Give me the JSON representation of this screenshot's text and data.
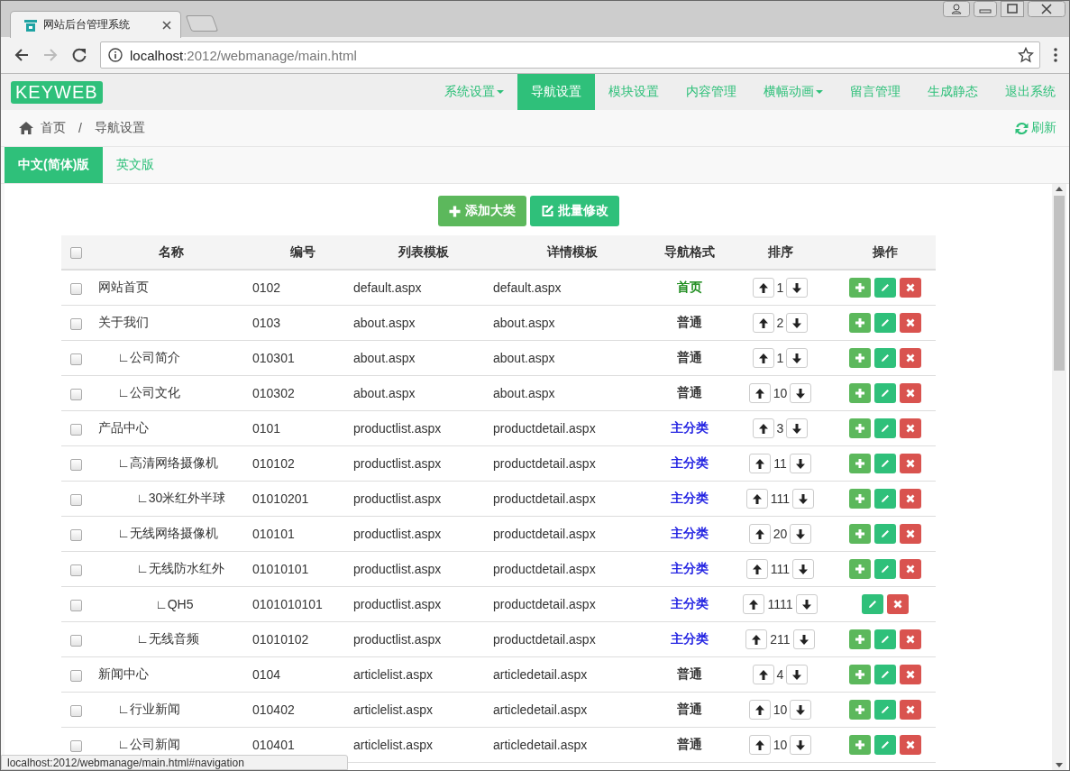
{
  "browser": {
    "tab_title": "网站后台管理系统",
    "url_host": "localhost",
    "url_path": ":2012/webmanage/main.html",
    "status_url": "localhost:2012/webmanage/main.html#navigation"
  },
  "app": {
    "logo": "KEYWEB",
    "nav": [
      {
        "label": "系统设置",
        "selected": false,
        "dropdown": true
      },
      {
        "label": "导航设置",
        "selected": true,
        "dropdown": false
      },
      {
        "label": "模块设置",
        "selected": false,
        "dropdown": false
      },
      {
        "label": "内容管理",
        "selected": false,
        "dropdown": false
      },
      {
        "label": "横幅动画",
        "selected": false,
        "dropdown": true
      },
      {
        "label": "留言管理",
        "selected": false,
        "dropdown": false
      },
      {
        "label": "生成静态",
        "selected": false,
        "dropdown": false
      },
      {
        "label": "退出系统",
        "selected": false,
        "dropdown": false
      }
    ]
  },
  "breadcrumb": [
    "首页",
    "导航设置"
  ],
  "breadcrumb_separator": "/",
  "refresh": "刷新",
  "lang_tabs": [
    {
      "label": "中文(简体)版",
      "selected": true
    },
    {
      "label": "英文版",
      "selected": false
    }
  ],
  "toolbar": [
    {
      "label": "添加大类",
      "kind": "add"
    },
    {
      "label": "批量修改",
      "kind": "edit"
    }
  ],
  "table": {
    "select_all_checked": false,
    "columns": [
      "名称",
      "编号",
      "列表模板",
      "详情模板",
      "导航格式",
      "排序",
      "操作"
    ],
    "rows": [
      {
        "name": "网站首页",
        "code": "0102",
        "list": "default.aspx",
        "detail": "default.aspx",
        "format": "首页",
        "color": "#1a8a1a",
        "order": "1",
        "checked": false,
        "can_add": true
      },
      {
        "name": "关于我们",
        "code": "0103",
        "list": "about.aspx",
        "detail": "about.aspx",
        "format": "普通",
        "color": "#333333",
        "order": "2",
        "checked": false,
        "can_add": true,
        "children": [
          {
            "name": "∟公司简介",
            "code": "010301",
            "list": "about.aspx",
            "detail": "about.aspx",
            "format": "普通",
            "color": "#333333",
            "order": "1",
            "checked": false,
            "can_add": true
          },
          {
            "name": "∟公司文化",
            "code": "010302",
            "list": "about.aspx",
            "detail": "about.aspx",
            "format": "普通",
            "color": "#333333",
            "order": "10",
            "checked": false,
            "can_add": true
          }
        ]
      },
      {
        "name": "产品中心",
        "code": "0101",
        "list": "productlist.aspx",
        "detail": "productdetail.aspx",
        "format": "主分类",
        "color": "#1515e0",
        "order": "3",
        "checked": false,
        "can_add": true,
        "children": [
          {
            "name": "∟高清网络摄像机",
            "code": "010102",
            "list": "productlist.aspx",
            "detail": "productdetail.aspx",
            "format": "主分类",
            "color": "#1515e0",
            "order": "11",
            "checked": false,
            "can_add": true,
            "children": [
              {
                "name": "∟30米红外半球",
                "code": "01010201",
                "list": "productlist.aspx",
                "detail": "productdetail.aspx",
                "format": "主分类",
                "color": "#1515e0",
                "order": "111",
                "checked": false,
                "can_add": true
              }
            ]
          },
          {
            "name": "∟无线网络摄像机",
            "code": "010101",
            "list": "productlist.aspx",
            "detail": "productdetail.aspx",
            "format": "主分类",
            "color": "#1515e0",
            "order": "20",
            "checked": false,
            "can_add": true,
            "children": [
              {
                "name": "∟无线防水红外",
                "code": "01010101",
                "list": "productlist.aspx",
                "detail": "productdetail.aspx",
                "format": "主分类",
                "color": "#1515e0",
                "order": "111",
                "checked": false,
                "can_add": true,
                "children": [
                  {
                    "name": "∟QH5",
                    "code": "0101010101",
                    "list": "productlist.aspx",
                    "detail": "productdetail.aspx",
                    "format": "主分类",
                    "color": "#1515e0",
                    "order": "1111",
                    "checked": false,
                    "can_add": false
                  }
                ]
              },
              {
                "name": "∟无线音频",
                "code": "01010102",
                "list": "productlist.aspx",
                "detail": "productdetail.aspx",
                "format": "主分类",
                "color": "#1515e0",
                "order": "211",
                "checked": false,
                "can_add": true
              }
            ]
          }
        ]
      },
      {
        "name": "新闻中心",
        "code": "0104",
        "list": "articlelist.aspx",
        "detail": "articledetail.aspx",
        "format": "普通",
        "color": "#333333",
        "order": "4",
        "checked": false,
        "can_add": true,
        "children": [
          {
            "name": "∟行业新闻",
            "code": "010402",
            "list": "articlelist.aspx",
            "detail": "articledetail.aspx",
            "format": "普通",
            "color": "#333333",
            "order": "10",
            "checked": false,
            "can_add": true
          },
          {
            "name": "∟公司新闻",
            "code": "010401",
            "list": "articlelist.aspx",
            "detail": "articledetail.aspx",
            "format": "普通",
            "color": "#333333",
            "order": "10",
            "checked": false,
            "can_add": true
          }
        ]
      }
    ]
  }
}
